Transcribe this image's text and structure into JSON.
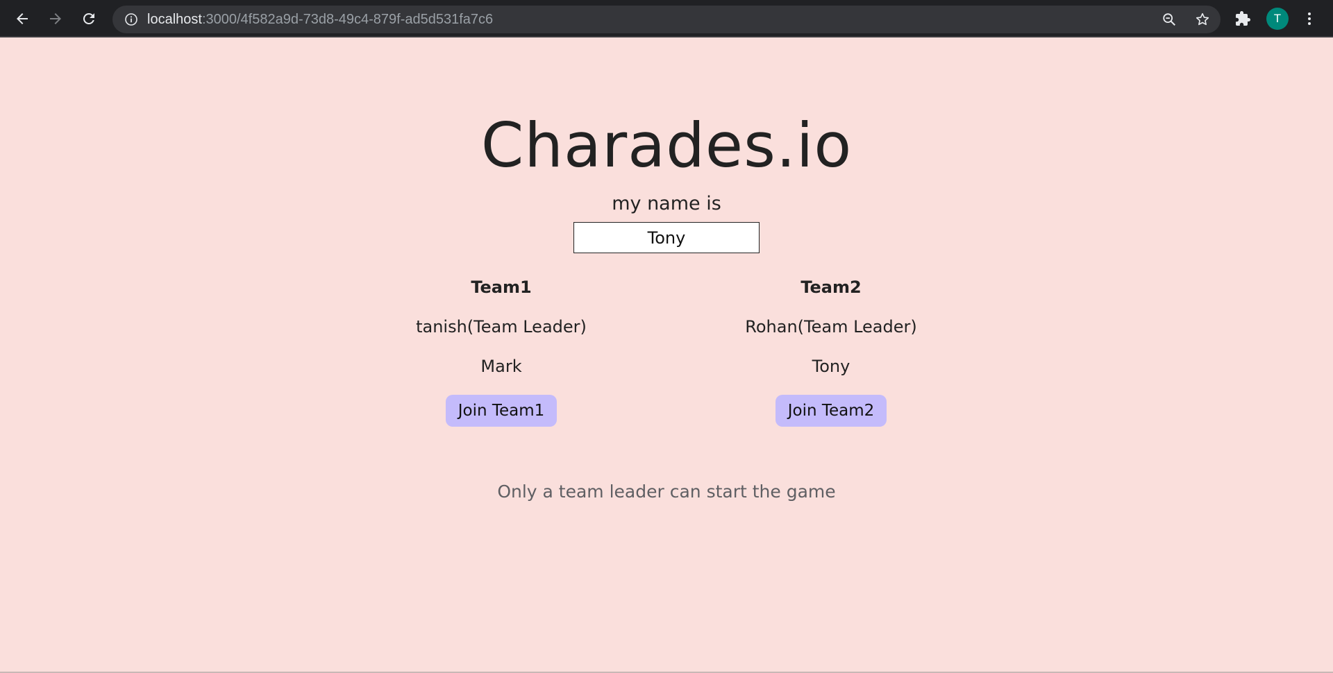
{
  "browser": {
    "url_host": "localhost",
    "url_path": ":3000/4f582a9d-73d8-49c4-879f-ad5d531fa7c6",
    "profile_initial": "T",
    "profile_color": "#00897b"
  },
  "app": {
    "title": "Charades.io",
    "name_label": "my name is",
    "name_value": "Tony",
    "background_color": "#fadfdc",
    "button_color": "#c4bbfb"
  },
  "teams": [
    {
      "title": "Team1",
      "members": [
        "tanish(Team Leader)",
        "Mark"
      ],
      "join_label": "Join Team1"
    },
    {
      "title": "Team2",
      "members": [
        "Rohan(Team Leader)",
        "Tony"
      ],
      "join_label": "Join Team2"
    }
  ],
  "footer": {
    "note": "Only a team leader can start the game"
  }
}
